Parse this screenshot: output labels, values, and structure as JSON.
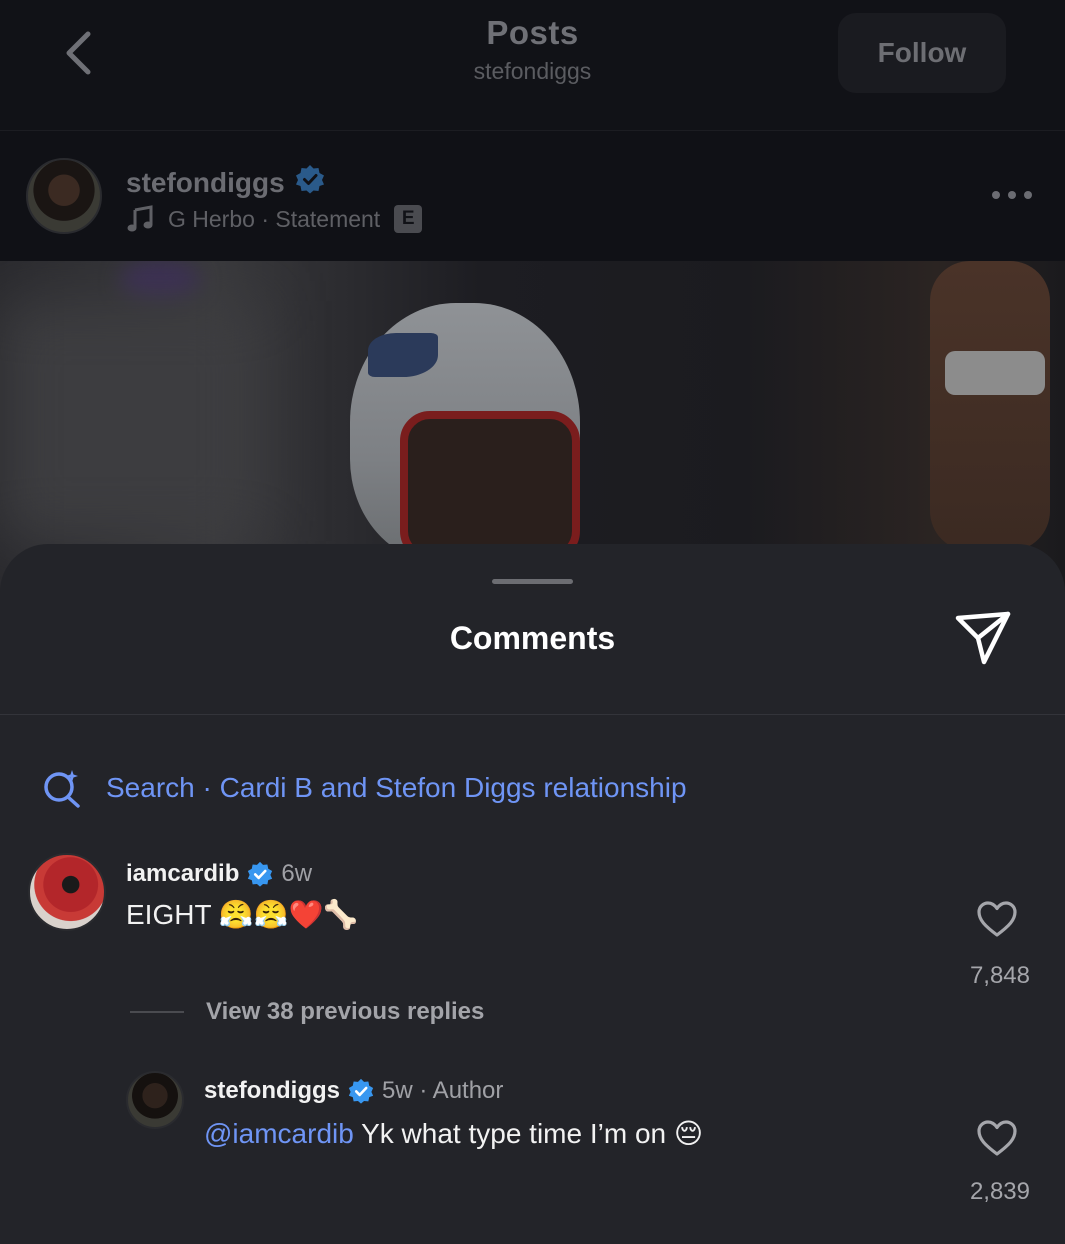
{
  "header": {
    "title": "Posts",
    "subtitle": "stefondiggs",
    "follow_label": "Follow"
  },
  "post": {
    "username": "stefondiggs",
    "music": "G Herbo · Statement",
    "explicit_badge": "E"
  },
  "comments_sheet": {
    "title": "Comments",
    "search_text": "Search · Cardi B and Stefon Diggs relationship",
    "comments": [
      {
        "username": "iamcardib",
        "time": "6w",
        "text": "EIGHT 😤😤❤️🦴",
        "likes": "7,848"
      }
    ],
    "view_replies_label": "View 38 previous replies",
    "reply": {
      "username": "stefondiggs",
      "meta": "5w · Author",
      "mention": "@iamcardib",
      "text": " Yk what type time I’m on 😔",
      "likes": "2,839"
    }
  },
  "colors": {
    "accent_blue": "#6f95f5",
    "verified_blue": "#3897f0",
    "sheet_bg": "#232429"
  }
}
